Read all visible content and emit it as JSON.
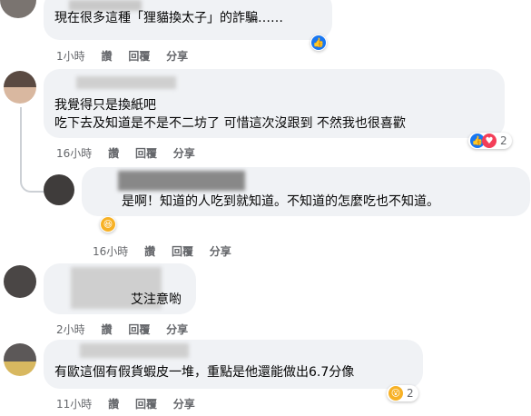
{
  "comments": [
    {
      "text": "現在很多這種「狸貓換太子」的詐騙……",
      "time": "1小時",
      "like": "讚",
      "reply": "回覆",
      "share": "分享"
    },
    {
      "line1": "我覺得只是換紙吧",
      "line2": "吃下去及知道是不是不二坊了 可惜這次沒跟到 不然我也很喜歡",
      "time": "16小時",
      "like": "讚",
      "reply": "回覆",
      "share": "分享",
      "reaction_count": "2"
    },
    {
      "text": "是啊！知道的人吃到就知道。不知道的怎麼吃也不知道。",
      "time": "16小時",
      "like": "讚",
      "reply": "回覆",
      "share": "分享"
    },
    {
      "text": "艾注意喲",
      "time": "2小時",
      "like": "讚",
      "reply": "回覆",
      "share": "分享"
    },
    {
      "text": "有歐這個有假貨蝦皮一堆，重點是他還能做出6.7分像",
      "time": "11小時",
      "like": "讚",
      "reply": "回覆",
      "share": "分享",
      "reaction_count": "2"
    }
  ],
  "colors": {
    "bubble": "#f0f2f5",
    "meta": "#65676b",
    "like_blue": "#1877f2",
    "wow_yellow": "#f7b125",
    "heart_red": "#f33e58"
  },
  "icons": [
    "like-icon",
    "heart-icon",
    "laugh-icon",
    "wow-icon"
  ]
}
